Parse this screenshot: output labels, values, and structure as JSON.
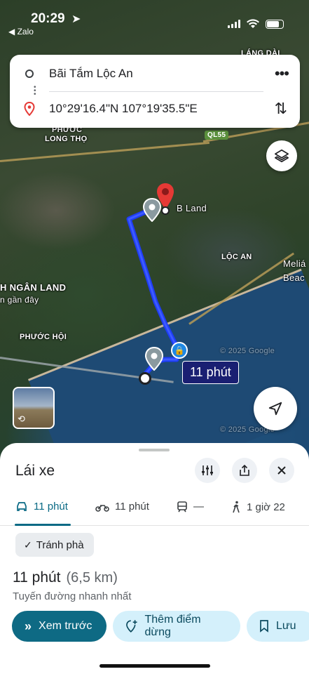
{
  "status_bar": {
    "time": "20:29",
    "back_app": "Zalo"
  },
  "search": {
    "origin": "Bãi Tắm Lộc An",
    "destination": "10°29'16.4\"N 107°19'35.5\"E"
  },
  "map": {
    "labels": {
      "lang_dai": "LÁNG DÀI",
      "phuoc": "PHƯỚC",
      "long_tho": "LONG THỌ",
      "ql55": "QL55",
      "b_land": "B Land",
      "loc_an": "LỘC AN",
      "melia": "Meliá",
      "beach": "Beac",
      "ngan_land": "H NGÂN LAND",
      "gan_day": "n gần đây",
      "phuoc_hoi": "PHƯỚC HỘI",
      "google1": "© 2025 Google",
      "google2": "© 2025 Google"
    },
    "eta_bubble": "11 phút",
    "route_color": "#1f3cff"
  },
  "sheet": {
    "title": "Lái xe",
    "modes": [
      {
        "label": "11 phút",
        "icon": "car-icon"
      },
      {
        "label": "11 phút",
        "icon": "motorbike-icon"
      },
      {
        "label": "—",
        "icon": "transit-icon"
      },
      {
        "label": "1 giờ 22",
        "icon": "walk-icon"
      }
    ],
    "avoid_chip": "Tránh phà",
    "duration": "11 phút",
    "distance": "(6,5 km)",
    "route_note": "Tuyến đường nhanh nhất",
    "actions": {
      "preview": "Xem trước",
      "add_stop": "Thêm điểm dừng",
      "save": "Lưu"
    }
  },
  "colors": {
    "accent": "#0e6a84",
    "secondary_btn": "#d4f0fb",
    "pin": "#e53935"
  }
}
